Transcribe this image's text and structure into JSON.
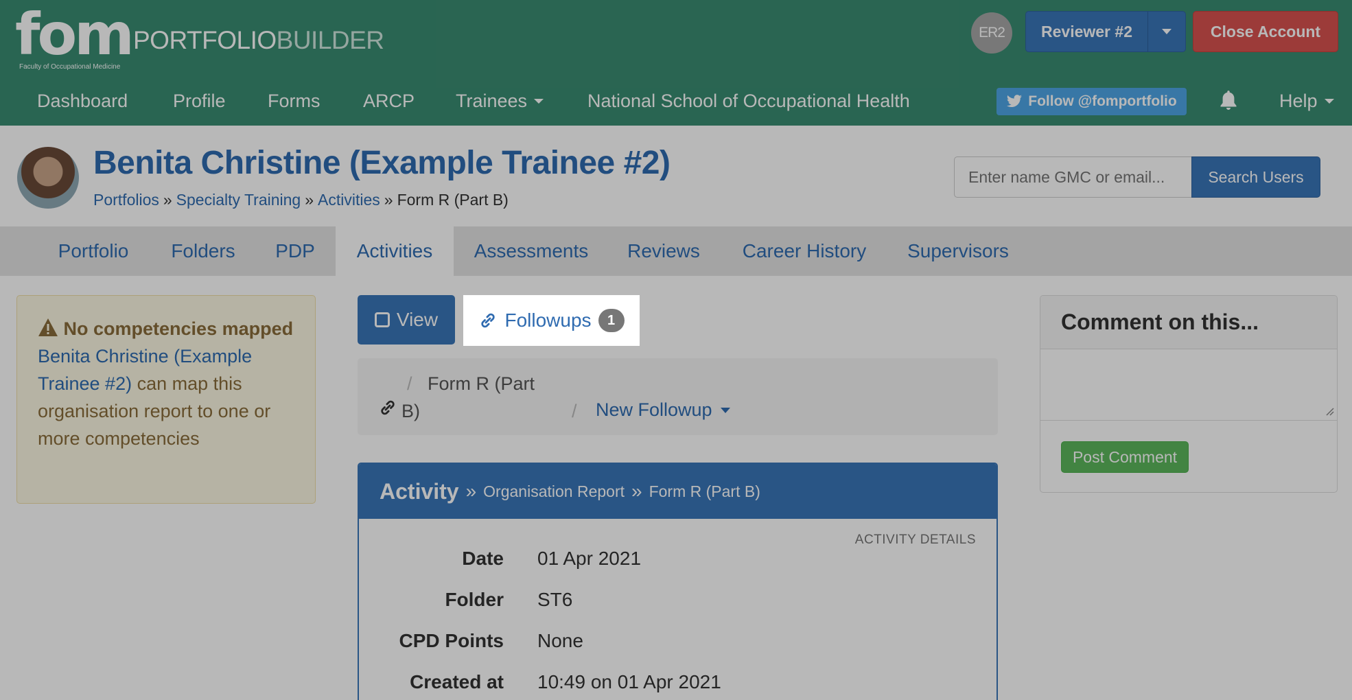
{
  "header": {
    "logo_text": "fom",
    "logo_subtitle": "Faculty of Occupational Medicine",
    "title_part1": "PORTFOLIO",
    "title_part2": "BUILDER",
    "user_initials": "ER2",
    "reviewer_label": "Reviewer #2",
    "close_account_label": "Close Account"
  },
  "nav": {
    "items": [
      {
        "label": "Dashboard"
      },
      {
        "label": "Profile"
      },
      {
        "label": "Forms"
      },
      {
        "label": "ARCP"
      },
      {
        "label": "Trainees"
      },
      {
        "label": "National School of Occupational Health"
      }
    ],
    "twitter_label": "Follow @fomportfolio",
    "help_label": "Help"
  },
  "page": {
    "title": "Benita Christine (Example Trainee #2)",
    "breadcrumb": [
      "Portfolios",
      "Specialty Training",
      "Activities",
      "Form R (Part B)"
    ],
    "breadcrumb_sep": "»"
  },
  "search": {
    "placeholder": "Enter name GMC or email...",
    "button_label": "Search Users"
  },
  "tabs": [
    {
      "label": "Portfolio",
      "active": false
    },
    {
      "label": "Folders",
      "active": false
    },
    {
      "label": "PDP",
      "active": false
    },
    {
      "label": "Activities",
      "active": true
    },
    {
      "label": "Assessments",
      "active": false
    },
    {
      "label": "Reviews",
      "active": false
    },
    {
      "label": "Career History",
      "active": false
    },
    {
      "label": "Supervisors",
      "active": false
    }
  ],
  "alert": {
    "heading": "No competencies mapped",
    "link_text": "Benita Christine (Example Trainee #2)",
    "body_text": "can map this organisation report to one or more competencies"
  },
  "subtabs": {
    "view_label": "View",
    "followups_label": "Followups",
    "followups_count": "1"
  },
  "crumbs": {
    "part1": "Form R (Part",
    "part2": "B)",
    "new_followup_label": "New Followup"
  },
  "activity": {
    "heading": "Activity",
    "type": "Organisation Report",
    "name": "Form R (Part B)",
    "details_label": "ACTIVITY DETAILS",
    "fields": [
      {
        "label": "Date",
        "value": "01 Apr 2021"
      },
      {
        "label": "Folder",
        "value": "ST6"
      },
      {
        "label": "CPD Points",
        "value": "None"
      },
      {
        "label": "Created at",
        "value": "10:49 on 01 Apr 2021"
      }
    ]
  },
  "comment": {
    "heading": "Comment on this...",
    "post_label": "Post Comment"
  },
  "colors": {
    "header_green": "#3a8c72",
    "primary_blue": "#3a76b9",
    "danger_red": "#d9534f",
    "success_green": "#5cb85c",
    "twitter_blue": "#4ea6e6"
  }
}
